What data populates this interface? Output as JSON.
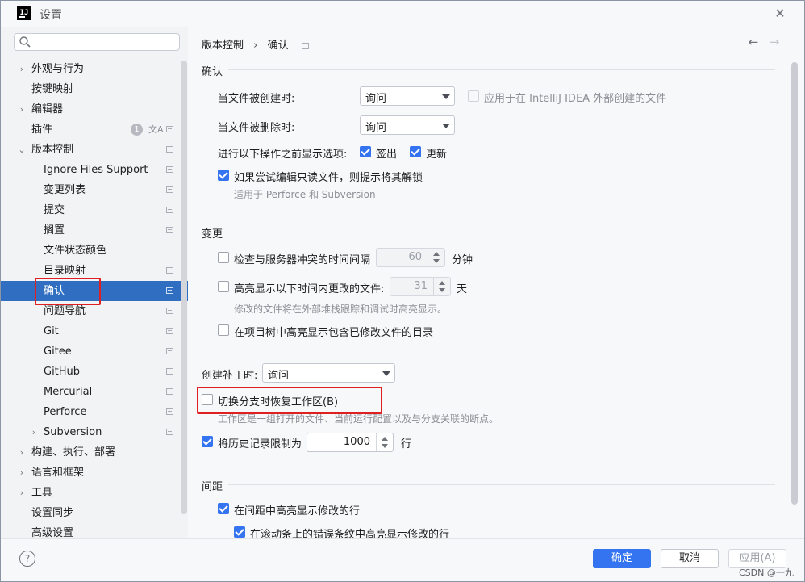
{
  "window": {
    "title": "设置",
    "logo": "IJ"
  },
  "search": {
    "placeholder": "Q·"
  },
  "tree": {
    "items": [
      {
        "label": "外观与行为",
        "expand": "›"
      },
      {
        "label": "按键映射"
      },
      {
        "label": "编辑器",
        "expand": "›"
      },
      {
        "label": "插件",
        "badge": "1",
        "translate": "文A"
      },
      {
        "label": "版本控制",
        "expand": "⌄"
      },
      {
        "label": "Ignore Files Support"
      },
      {
        "label": "变更列表"
      },
      {
        "label": "提交"
      },
      {
        "label": "搁置"
      },
      {
        "label": "文件状态颜色"
      },
      {
        "label": "目录映射"
      },
      {
        "label": "确认"
      },
      {
        "label": "问题导航"
      },
      {
        "label": "Git"
      },
      {
        "label": "Gitee"
      },
      {
        "label": "GitHub"
      },
      {
        "label": "Mercurial"
      },
      {
        "label": "Perforce"
      },
      {
        "label": "Subversion",
        "expand": "›"
      },
      {
        "label": "构建、执行、部署",
        "expand": "›"
      },
      {
        "label": "语言和框架",
        "expand": "›"
      },
      {
        "label": "工具",
        "expand": "›"
      },
      {
        "label": "设置同步"
      },
      {
        "label": "高级设置"
      }
    ]
  },
  "breadcrumb": {
    "parent": "版本控制",
    "sep": "›",
    "current": "确认"
  },
  "nav": {
    "back": "←",
    "forward": "→"
  },
  "confirm_section": {
    "title": "确认",
    "on_create_label": "当文件被创建时:",
    "on_create_value": "询问",
    "apply_outside_label": "应用于在 IntelliJ IDEA 外部创建的文件",
    "on_delete_label": "当文件被删除时:",
    "on_delete_value": "询问",
    "show_options_label": "进行以下操作之前显示选项:",
    "checkout_label": "签出",
    "update_label": "更新",
    "readonly_label": "如果尝试编辑只读文件，则提示将其解锁",
    "readonly_hint": "适用于 Perforce 和 Subversion"
  },
  "changes_section": {
    "title": "变更",
    "check_conflict_label": "检查与服务器冲突的时间间隔",
    "check_conflict_value": "60",
    "check_conflict_unit": "分钟",
    "highlight_label": "高亮显示以下时间内更改的文件:",
    "highlight_value": "31",
    "highlight_unit": "天",
    "highlight_hint": "修改的文件将在外部堆栈跟踪和调试时高亮显示。",
    "highlight_dirs_label": "在项目树中高亮显示包含已修改文件的目录"
  },
  "patch": {
    "label": "创建补丁时:",
    "value": "询问"
  },
  "restore_workspace": {
    "label": "切换分支时恢复工作区(B)",
    "hint": "工作区是一组打开的文件、当前运行配置以及与分支关联的断点。"
  },
  "history_limit": {
    "label": "将历史记录限制为",
    "value": "1000",
    "unit": "行"
  },
  "gutter_section": {
    "title": "间距",
    "highlight_gutter_label": "在间距中高亮显示修改的行",
    "highlight_scrollbar_label": "在滚动条上的错误条纹中高亮显示修改的行"
  },
  "buttons": {
    "help": "?",
    "ok": "确定",
    "cancel": "取消",
    "apply": "应用(A)"
  },
  "watermark": "CSDN @一九",
  "colors": {
    "accent": "#3574f0",
    "selection": "#2f6ec1",
    "annotation": "#e02020"
  }
}
